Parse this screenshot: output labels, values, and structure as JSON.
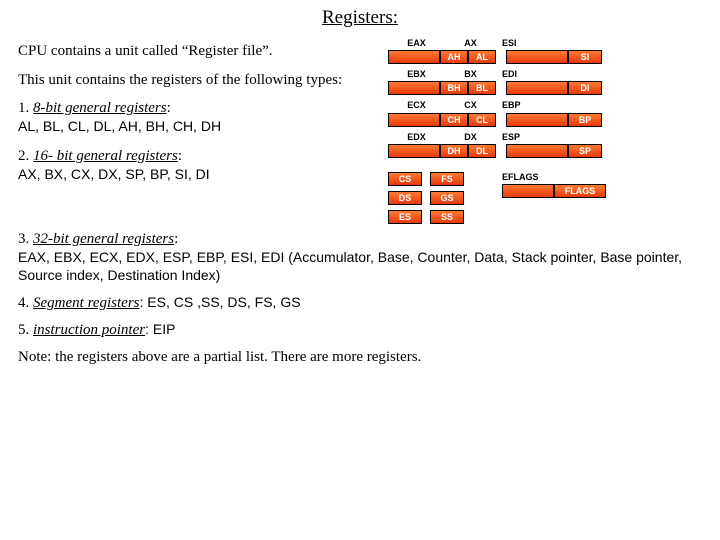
{
  "title": "Registers:",
  "intro1": "CPU contains a unit called “Register file”.",
  "intro2": "This unit contains the registers of the following types:",
  "sections": {
    "s1": {
      "num": "1. ",
      "head": "8-bit general registers",
      "body": "AL, BL, CL, DL, AH, BH, CH, DH"
    },
    "s2": {
      "num": "2. ",
      "head": "16- bit general registers",
      "body": "AX, BX, CX, DX, SP, BP, SI, DI"
    },
    "s3": {
      "num": "3. ",
      "head": "32-bit general registers",
      "body": "EAX, EBX, ECX, EDX, ESP, EBP, ESI, EDI (Accumulator, Base, Counter, Data, Stack pointer, Base pointer, Source index, Destination Index)"
    },
    "s4": {
      "num": "4. ",
      "head": "Segment registers",
      "body": ": ES, CS ,SS, DS, FS, GS"
    },
    "s5": {
      "num": "5. ",
      "head": "instruction pointer",
      "body": ": EIP"
    }
  },
  "note": "Note: the registers above are a partial list. There are more registers.",
  "diagram": {
    "left": [
      {
        "outer": "EAX",
        "sixteen": "AX",
        "hi": "AH",
        "lo": "AL"
      },
      {
        "outer": "EBX",
        "sixteen": "BX",
        "hi": "BH",
        "lo": "BL"
      },
      {
        "outer": "ECX",
        "sixteen": "CX",
        "hi": "CH",
        "lo": "CL"
      },
      {
        "outer": "EDX",
        "sixteen": "DX",
        "hi": "DH",
        "lo": "DL"
      }
    ],
    "segs": [
      "CS",
      "DS",
      "ES",
      "FS",
      "GS",
      "SS"
    ],
    "right": [
      {
        "outer": "ESI",
        "half": "SI"
      },
      {
        "outer": "EDI",
        "half": "DI"
      },
      {
        "outer": "EBP",
        "half": "BP"
      },
      {
        "outer": "ESP",
        "half": "SP"
      }
    ],
    "flags": {
      "outer": "EFLAGS",
      "half": "FLAGS"
    }
  }
}
